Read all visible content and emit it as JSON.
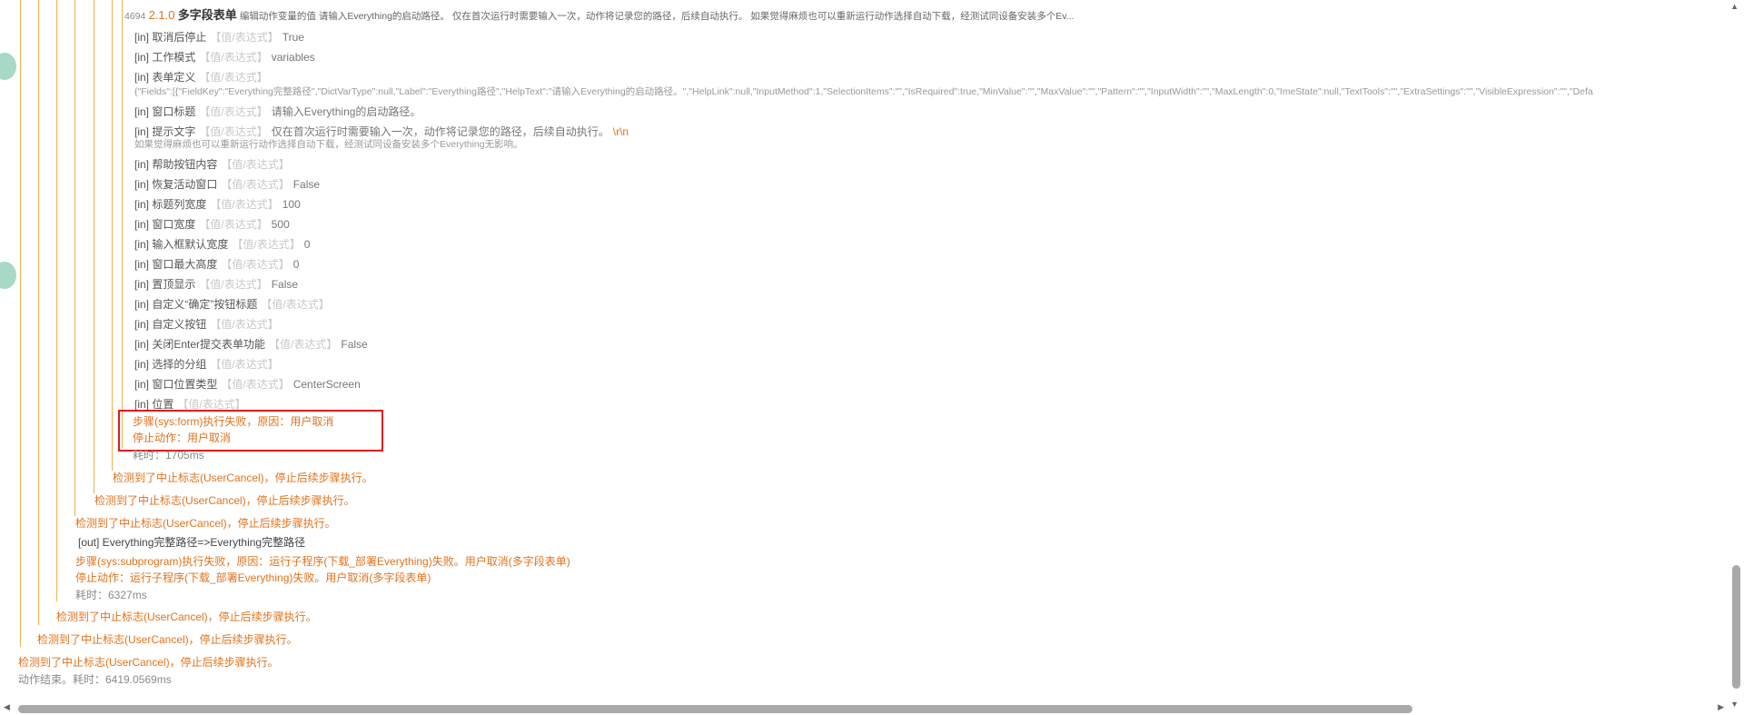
{
  "header": {
    "step_id": "4694",
    "version": "2.1.0",
    "action_name": "多字段表单",
    "description": "编辑动作变量的值 请输入Everything的启动路径。 仅在首次运行时需要输入一次，动作将记录您的路径，后续自动执行。 如果觉得麻烦也可以重新运行动作选择自动下载，经测试同设备安装多个Ev..."
  },
  "placeholder": "【值/表达式】",
  "params": [
    {
      "tag": "[in]",
      "name": "取消后停止",
      "value": "True"
    },
    {
      "tag": "[in]",
      "name": "工作模式",
      "value": "variables"
    },
    {
      "tag": "[in]",
      "name": "表单定义",
      "value": ""
    },
    {
      "tag": "[in]",
      "name": "窗口标题",
      "value": "请输入Everything的启动路径。"
    },
    {
      "tag": "[in]",
      "name": "提示文字",
      "value": "仅在首次运行时需要输入一次，动作将记录您的路径，后续自动执行。"
    },
    {
      "tag": "[in]",
      "name": "帮助按钮内容",
      "value": ""
    },
    {
      "tag": "[in]",
      "name": "恢复活动窗口",
      "value": "False"
    },
    {
      "tag": "[in]",
      "name": "标题列宽度",
      "value": "100"
    },
    {
      "tag": "[in]",
      "name": "窗口宽度",
      "value": "500"
    },
    {
      "tag": "[in]",
      "name": "输入框默认宽度",
      "value": "0"
    },
    {
      "tag": "[in]",
      "name": "窗口最大高度",
      "value": "0"
    },
    {
      "tag": "[in]",
      "name": "置顶显示",
      "value": "False"
    },
    {
      "tag": "[in]",
      "name": "自定义“确定”按钮标题",
      "value": ""
    },
    {
      "tag": "[in]",
      "name": "自定义按钮",
      "value": ""
    },
    {
      "tag": "[in]",
      "name": "关闭Enter提交表单功能",
      "value": "False"
    },
    {
      "tag": "[in]",
      "name": "选择的分组",
      "value": ""
    },
    {
      "tag": "[in]",
      "name": "窗口位置类型",
      "value": "CenterScreen"
    },
    {
      "tag": "[in]",
      "name": "位置",
      "value": ""
    }
  ],
  "form_json": "{\"Fields\":[{\"FieldKey\":\"Everything完整路径\",\"DictVarType\":null,\"Label\":\"Everything路径\",\"HelpText\":\"请输入Everything的启动路径。\",\"HelpLink\":null,\"InputMethod\":1,\"SelectionItems\":\"\",\"IsRequired\":true,\"MinValue\":\"\",\"MaxValue\":\"\",\"Pattern\":\"\",\"InputWidth\":\"\",\"MaxLength\":0,\"ImeState\":null,\"TextTools\":\"\",\"ExtraSettings\":\"\",\"VisibleExpression\":\"\",\"Defa",
  "prompt_escape": "\\r\\n",
  "prompt_line2": "如果觉得麻烦也可以重新运行动作选择自动下载，经测试同设备安装多个Everything无影响。",
  "error_box": {
    "line1": "步骤(sys:form)执行失败，原因：用户取消",
    "line2": "停止动作：用户取消"
  },
  "elapsed1": "耗时：1705ms",
  "log": {
    "cancel_msg": "检测到了中止标志(UserCancel)，停止后续步骤执行。",
    "out_line": "[out] Everything完整路径=>Everything完整路径",
    "subprogram_fail": "步骤(sys:subprogram)执行失败，原因：运行子程序(下载_部署Everything)失败。用户取消(多字段表单)",
    "subprogram_stop": "停止动作：运行子程序(下载_部署Everything)失败。用户取消(多字段表单)",
    "elapsed2": "耗时：6327ms",
    "finish": "动作结束。耗时：6419.0569ms"
  },
  "colors": {
    "accent_orange": "#e0731e",
    "tree_line": "#f0b24a",
    "error_border": "#e01c1c"
  }
}
